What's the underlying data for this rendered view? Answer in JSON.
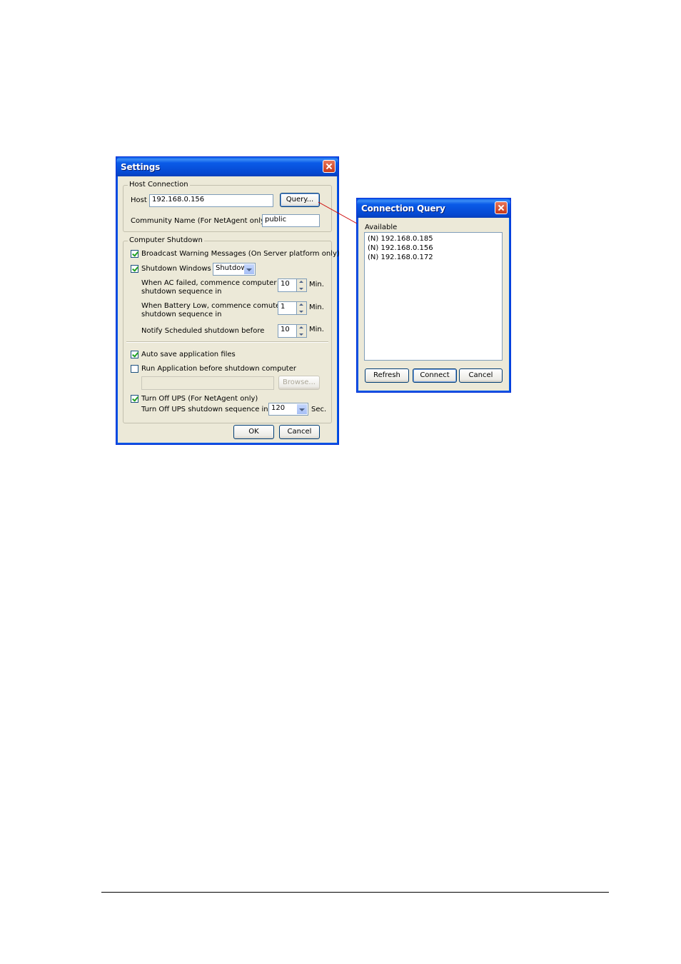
{
  "settings": {
    "title": "Settings",
    "host_connection": {
      "legend": "Host Connection",
      "host_label": "Host",
      "host_value": "192.168.0.156",
      "query_button": "Query...",
      "community_label": "Community Name (For NetAgent only):",
      "community_value": "public"
    },
    "computer_shutdown": {
      "legend": "Computer Shutdown",
      "broadcast_label": "Broadcast Warning Messages (On Server platform only)",
      "broadcast_checked": true,
      "shutdown_windows_label": "Shutdown Windows by",
      "shutdown_windows_checked": true,
      "shutdown_method": "Shutdown",
      "ac_failed_line1": "When AC failed, commence computer",
      "ac_failed_line2": "shutdown sequence in",
      "ac_failed_value": "10",
      "ac_failed_unit": "Min.",
      "battery_low_line1": "When Battery Low, commence comuter",
      "battery_low_line2": "shutdown sequence in",
      "battery_low_value": "1",
      "battery_low_unit": "Min.",
      "notify_label": "Notify Scheduled shutdown before",
      "notify_value": "10",
      "notify_unit": "Min.",
      "auto_save_label": "Auto save application files",
      "auto_save_checked": true,
      "run_app_label": "Run Application before shutdown computer",
      "run_app_checked": false,
      "run_app_path": "",
      "browse_button": "Browse...",
      "turn_off_ups_label": "Turn Off UPS (For NetAgent only)",
      "turn_off_ups_checked": true,
      "turn_off_seq_label": "Turn Off UPS shutdown sequence in",
      "turn_off_seq_value": "120",
      "turn_off_seq_unit": "Sec."
    },
    "ok_button": "OK",
    "cancel_button": "Cancel"
  },
  "connection_query": {
    "title": "Connection Query",
    "available_label": "Available",
    "hosts": [
      "(N) 192.168.0.185",
      "(N) 192.168.0.156",
      "(N) 192.168.0.172"
    ],
    "refresh_button": "Refresh",
    "connect_button": "Connect",
    "cancel_button": "Cancel"
  },
  "colors": {
    "titlebar": "#0a5be8",
    "dialog_bg": "#ece9d8",
    "callout_line": "#cc0000"
  }
}
